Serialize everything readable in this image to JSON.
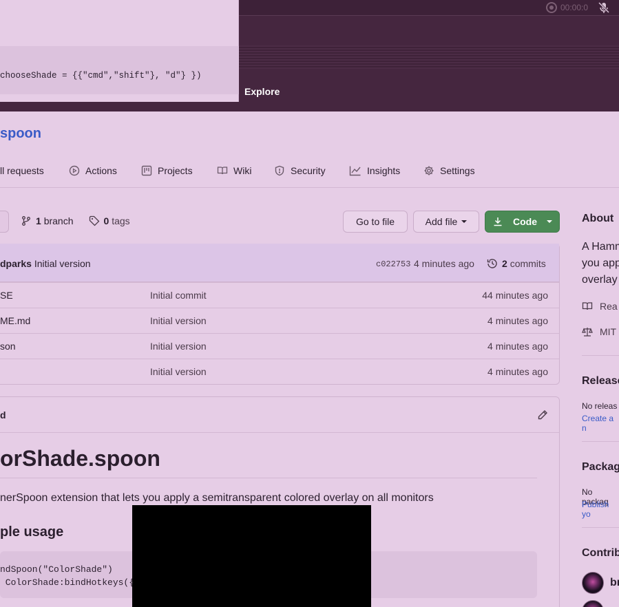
{
  "system_bar": {
    "recording_time": "00:00:0"
  },
  "overlay_popup": {
    "code_line": "chooseShade = {{\"cmd\",\"shift\"}, \"d\"} })"
  },
  "header_nav": {
    "explore_label": "Explore"
  },
  "repo": {
    "name_fragment": "spoon"
  },
  "tabs": [
    {
      "label": "ll requests",
      "icon": "pull-request-icon"
    },
    {
      "label": "Actions",
      "icon": "play-circle-icon"
    },
    {
      "label": "Projects",
      "icon": "project-board-icon"
    },
    {
      "label": "Wiki",
      "icon": "book-icon"
    },
    {
      "label": "Security",
      "icon": "shield-icon"
    },
    {
      "label": "Insights",
      "icon": "graph-icon"
    },
    {
      "label": "Settings",
      "icon": "gear-icon"
    }
  ],
  "branch_bar": {
    "branch_count": "1",
    "branch_label": "branch",
    "tag_count": "0",
    "tag_label": "tags",
    "go_to_file": "Go to file",
    "add_file": "Add file",
    "code": "Code"
  },
  "latest_commit": {
    "author": "dparks",
    "message": "Initial version",
    "hash": "c022753",
    "time": "4 minutes ago",
    "commit_count": "2",
    "commit_label": "commits"
  },
  "files": [
    {
      "name": "SE",
      "message": "Initial commit",
      "time": "44 minutes ago"
    },
    {
      "name": "ME.md",
      "message": "Initial version",
      "time": "4 minutes ago"
    },
    {
      "name": "son",
      "message": "Initial version",
      "time": "4 minutes ago"
    },
    {
      "name": "",
      "message": "Initial version",
      "time": "4 minutes ago"
    }
  ],
  "readme": {
    "file_label": "d",
    "heading": "orShade.spoon",
    "description": "nerSpoon extension that lets you apply a semitransparent colored overlay on all monitors",
    "usage_heading": "ple usage",
    "code_line1": "ndSpoon(\"ColorShade\")",
    "code_line2": " ColorShade:bindHotkeys({ c"
  },
  "sidebar": {
    "about_title": "About",
    "about_line1": "A Hamm",
    "about_line2": "you app",
    "about_line3": "overlay",
    "readme_link": "Rea",
    "license": "MIT",
    "releases_title": "Release",
    "releases_text": "No releas",
    "releases_link": "Create a n",
    "packages_title": "Packag",
    "packages_text": "No packag",
    "packages_link": "Publish yo",
    "contributors_title": "Contrib",
    "contributor1": "br"
  }
}
